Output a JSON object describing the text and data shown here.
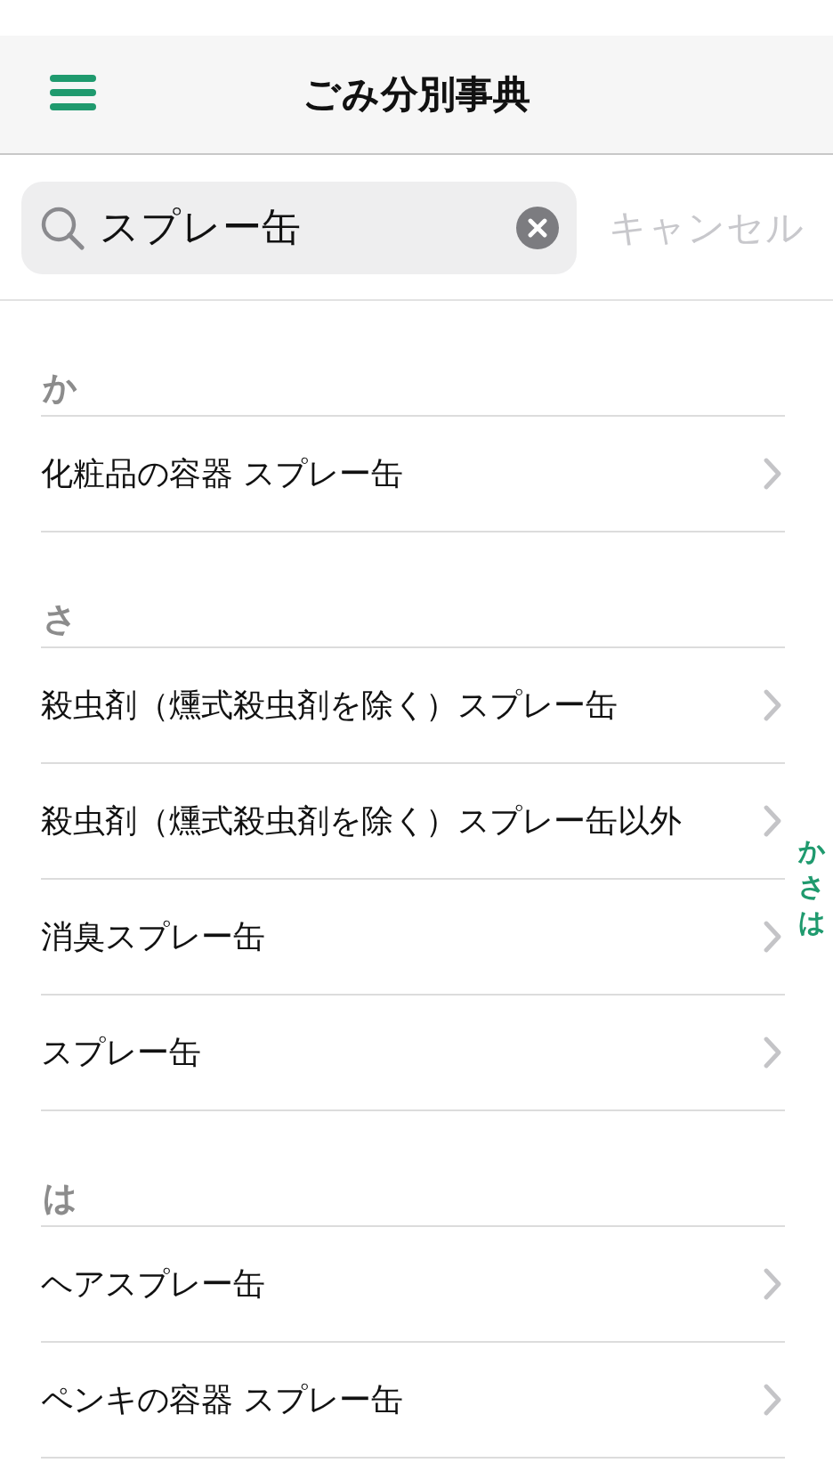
{
  "header": {
    "title": "ごみ分別事典"
  },
  "search": {
    "value": "スプレー缶",
    "cancel": "キャンセル"
  },
  "sections": [
    {
      "heading": "か",
      "items": [
        "化粧品の容器 スプレー缶"
      ]
    },
    {
      "heading": "さ",
      "items": [
        "殺虫剤（燻式殺虫剤を除く）スプレー缶",
        "殺虫剤（燻式殺虫剤を除く）スプレー缶以外",
        "消臭スプレー缶",
        "スプレー缶"
      ]
    },
    {
      "heading": "は",
      "items": [
        "ヘアスプレー缶",
        "ペンキの容器 スプレー缶"
      ]
    }
  ],
  "index": [
    "か",
    "さ",
    "は"
  ]
}
